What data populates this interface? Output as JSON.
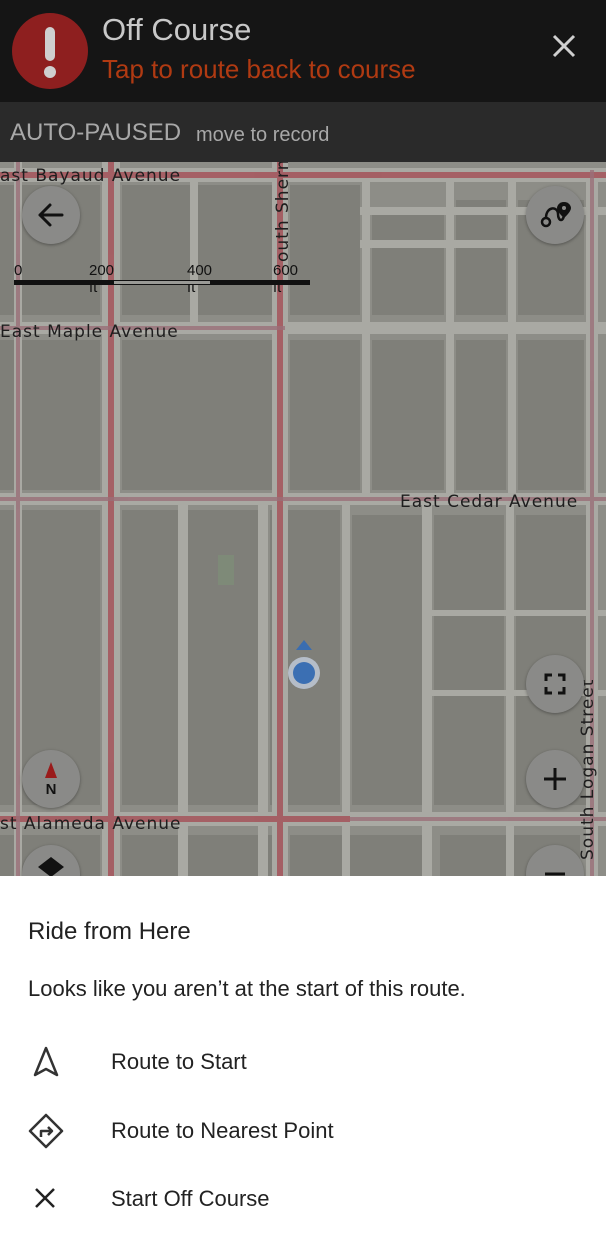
{
  "banner": {
    "title": "Off Course",
    "subtitle": "Tap to route back to course",
    "alert_icon": "exclamation-circle-icon",
    "close_icon": "close-icon",
    "accent_color": "#b03a12"
  },
  "pause_bar": {
    "status": "AUTO-PAUSED",
    "hint": "move to record"
  },
  "map": {
    "streets": {
      "bayaud": "ast Bayaud Avenue",
      "maple": "East Maple Avenue",
      "cedar": "East Cedar Avenue",
      "alameda": "st Alameda Avenue",
      "sherman": "outh Sherman Str",
      "logan": "South Logan Street"
    },
    "scale": {
      "l0": "0",
      "l1": "200 ft",
      "l2": "400 ft",
      "l3": "600 ft"
    },
    "compass_label": "N",
    "controls": [
      "back-arrow-icon",
      "route-options-icon",
      "fullscreen-icon",
      "zoom-in-icon",
      "zoom-out-icon",
      "compass-icon",
      "layers-icon"
    ]
  },
  "sheet": {
    "title": "Ride from Here",
    "message": "Looks like you aren’t at the start of this route.",
    "options": [
      {
        "label": "Route to Start",
        "icon": "navigation-arrow-icon"
      },
      {
        "label": "Route to Nearest Point",
        "icon": "turn-right-diamond-icon"
      },
      {
        "label": "Start Off Course",
        "icon": "close-icon"
      }
    ]
  }
}
